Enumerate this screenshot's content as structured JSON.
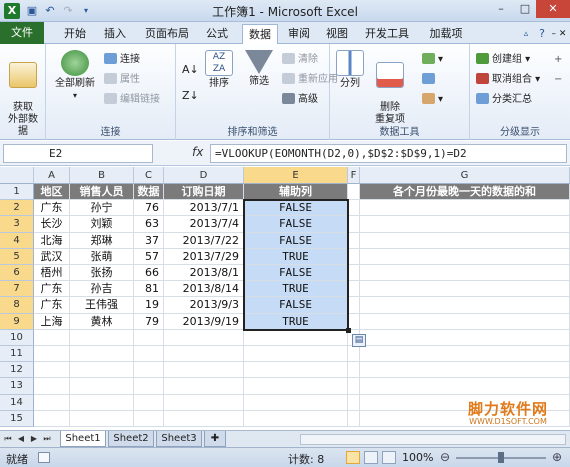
{
  "window": {
    "title": "工作簿1 - Microsoft Excel"
  },
  "ribbon_tabs": [
    "文件",
    "开始",
    "插入",
    "页面布局",
    "公式",
    "数据",
    "审阅",
    "视图",
    "开发工具",
    "加载项"
  ],
  "active_tab": "数据",
  "groups": {
    "get_external": {
      "label": "获取\n外部数据"
    },
    "connections": {
      "name": "连接",
      "refresh_all": "全部刷新",
      "connections": "连接",
      "properties": "属性",
      "edit_links": "编辑链接"
    },
    "sort_filter": {
      "name": "排序和筛选",
      "sort": "排序",
      "filter": "筛选",
      "clear": "清除",
      "reapply": "重新应用",
      "advanced": "高级"
    },
    "data_tools": {
      "name": "数据工具",
      "split": "分列",
      "remove_dup": "删除\n重复项"
    },
    "outline": {
      "name": "分级显示",
      "group": "创建组",
      "ungroup": "取消组合",
      "subtotal": "分类汇总"
    }
  },
  "formula_bar": {
    "name_box": "E2",
    "fx": "fx",
    "formula": "=VLOOKUP(EOMONTH(D2,0),$D$2:$D$9,1)=D2"
  },
  "columns": [
    "A",
    "B",
    "C",
    "D",
    "E",
    "F",
    "G"
  ],
  "rows": [
    "1",
    "2",
    "3",
    "4",
    "5",
    "6",
    "7",
    "8",
    "9",
    "10",
    "11",
    "12",
    "13",
    "14",
    "15"
  ],
  "table": {
    "headers": [
      "地区",
      "销售人员",
      "数据",
      "订购日期",
      "辅助列"
    ],
    "note": "各个月份最晚一天的数据的和",
    "data": [
      [
        "广东",
        "孙宁",
        "76",
        "2013/7/1",
        "FALSE"
      ],
      [
        "长沙",
        "刘颖",
        "63",
        "2013/7/4",
        "FALSE"
      ],
      [
        "北海",
        "郑琳",
        "37",
        "2013/7/22",
        "FALSE"
      ],
      [
        "武汉",
        "张萌",
        "57",
        "2013/7/29",
        "TRUE"
      ],
      [
        "梧州",
        "张扬",
        "66",
        "2013/8/1",
        "FALSE"
      ],
      [
        "广东",
        "孙吉",
        "81",
        "2013/8/14",
        "TRUE"
      ],
      [
        "广东",
        "王伟强",
        "19",
        "2013/9/3",
        "FALSE"
      ],
      [
        "上海",
        "黄林",
        "79",
        "2013/9/19",
        "TRUE"
      ]
    ]
  },
  "sheets": [
    "Sheet1",
    "Sheet2",
    "Sheet3"
  ],
  "active_sheet": "Sheet1",
  "status": {
    "mode": "就绪",
    "count": "计数: 8",
    "zoom": "100%"
  },
  "watermark": {
    "line1": "脚力软件网",
    "line2": "WWW.D1SOFT.COM"
  }
}
